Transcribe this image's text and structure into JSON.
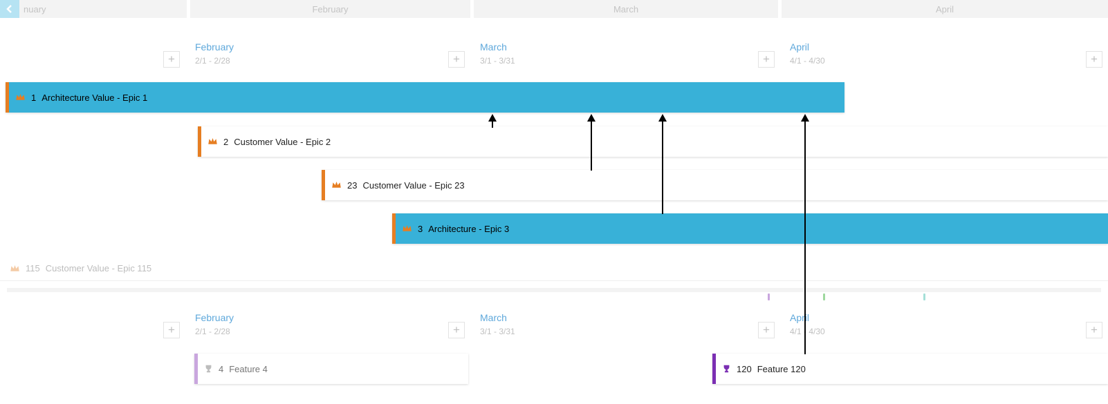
{
  "months_strip": [
    "nuary",
    "February",
    "March",
    "April"
  ],
  "periods_a": [
    {
      "name": "February",
      "range": "2/1 - 2/28"
    },
    {
      "name": "March",
      "range": "3/1 - 3/31"
    },
    {
      "name": "April",
      "range": "4/1 - 4/30"
    }
  ],
  "periods_b": [
    {
      "name": "February",
      "range": "2/1 - 2/28"
    },
    {
      "name": "March",
      "range": "3/1 - 3/31"
    },
    {
      "name": "April",
      "range": "4/1 - 4/30"
    }
  ],
  "epics": [
    {
      "id": "1",
      "title": "Architecture Value - Epic 1"
    },
    {
      "id": "2",
      "title": "Customer Value - Epic 2"
    },
    {
      "id": "23",
      "title": "Customer Value - Epic 23"
    },
    {
      "id": "3",
      "title": "Architecture - Epic 3"
    },
    {
      "id": "115",
      "title": "Customer Value - Epic 115"
    }
  ],
  "features": [
    {
      "id": "4",
      "title": "Feature 4"
    },
    {
      "id": "120",
      "title": "Feature 120"
    }
  ],
  "colors": {
    "teal": "#38b1d8",
    "orange_accent": "#e67e22",
    "purple_accent": "#7b2fb3",
    "lilac_accent": "#c9a6de",
    "period_blue": "#5ea8db"
  }
}
